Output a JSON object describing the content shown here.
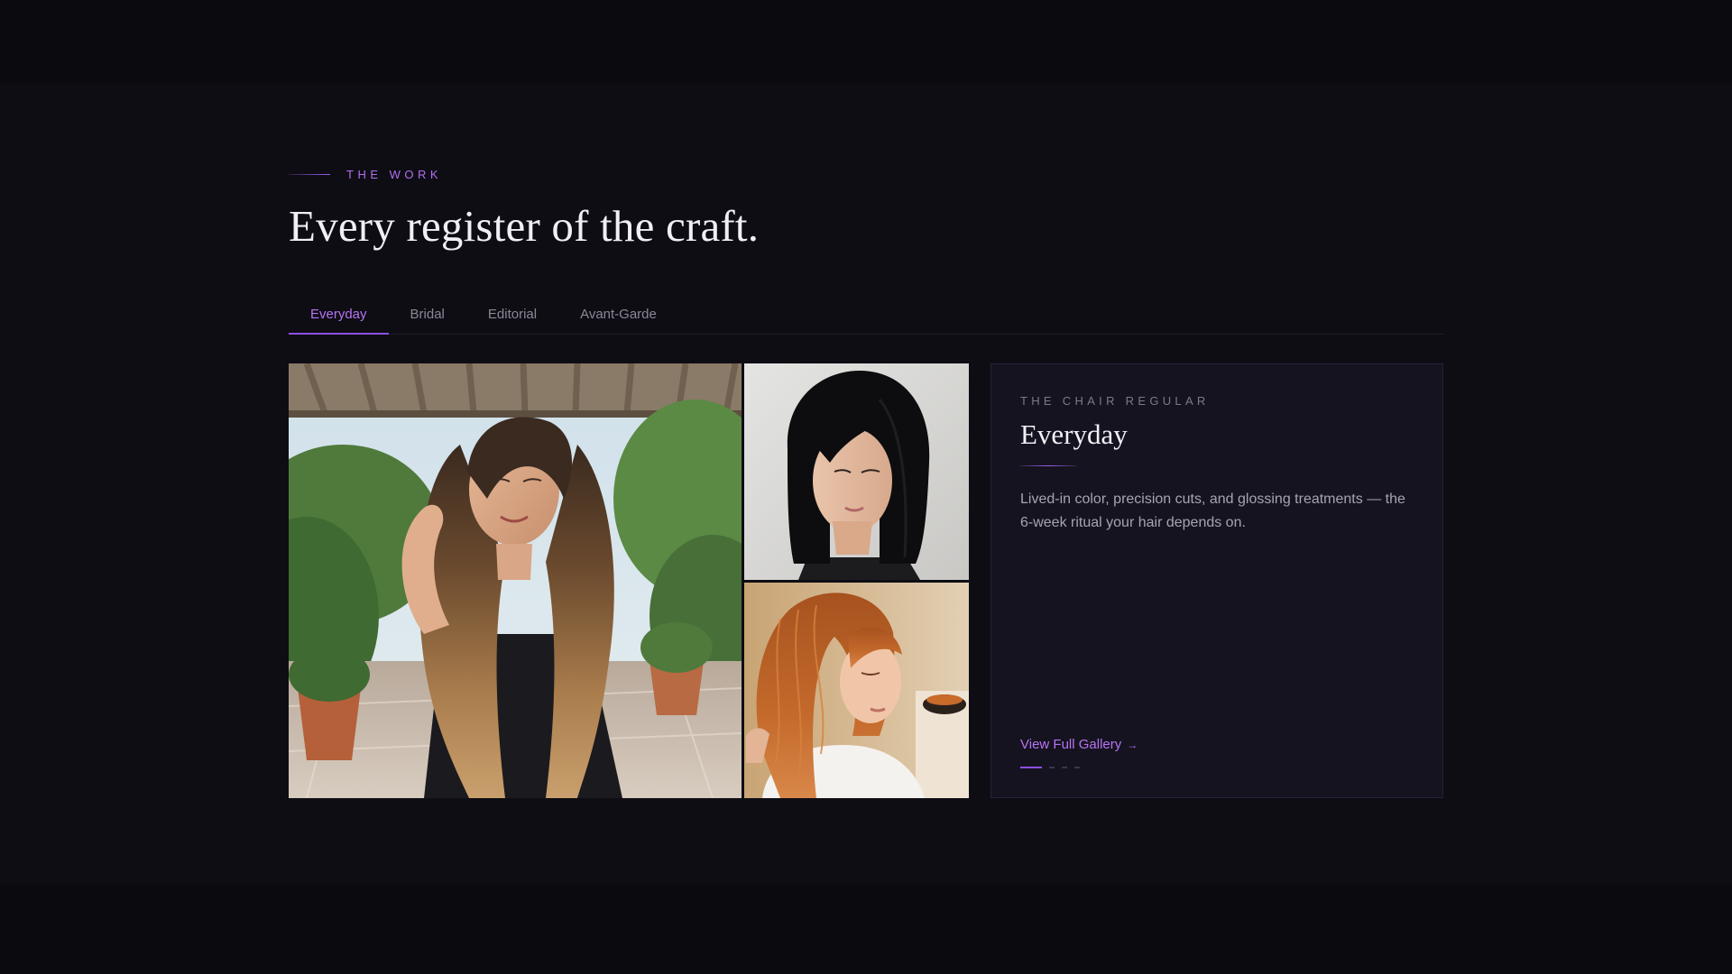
{
  "section": {
    "eyebrow": "THE WORK",
    "heading": "Every register of the craft."
  },
  "tabs": [
    {
      "label": "Everyday",
      "active": true
    },
    {
      "label": "Bridal",
      "active": false
    },
    {
      "label": "Editorial",
      "active": false
    },
    {
      "label": "Avant-Garde",
      "active": false
    }
  ],
  "gallery": {
    "photos": [
      {
        "name": "long-balayage-waves-photo"
      },
      {
        "name": "black-bob-photo"
      },
      {
        "name": "copper-waves-photo"
      }
    ]
  },
  "card": {
    "eyebrow": "THE CHAIR REGULAR",
    "title": "Everyday",
    "description": "Lived-in color, precision cuts, and glossing treatments — the 6-week ritual your hair depends on.",
    "link_label": "View Full Gallery",
    "link_icon": "→",
    "dots": {
      "count": 4,
      "active_index": 0
    }
  },
  "colors": {
    "accent": "#b574f4",
    "accent_line": "#8d4fe6",
    "background": "#0e0d14",
    "card_bg": "#15131f"
  }
}
